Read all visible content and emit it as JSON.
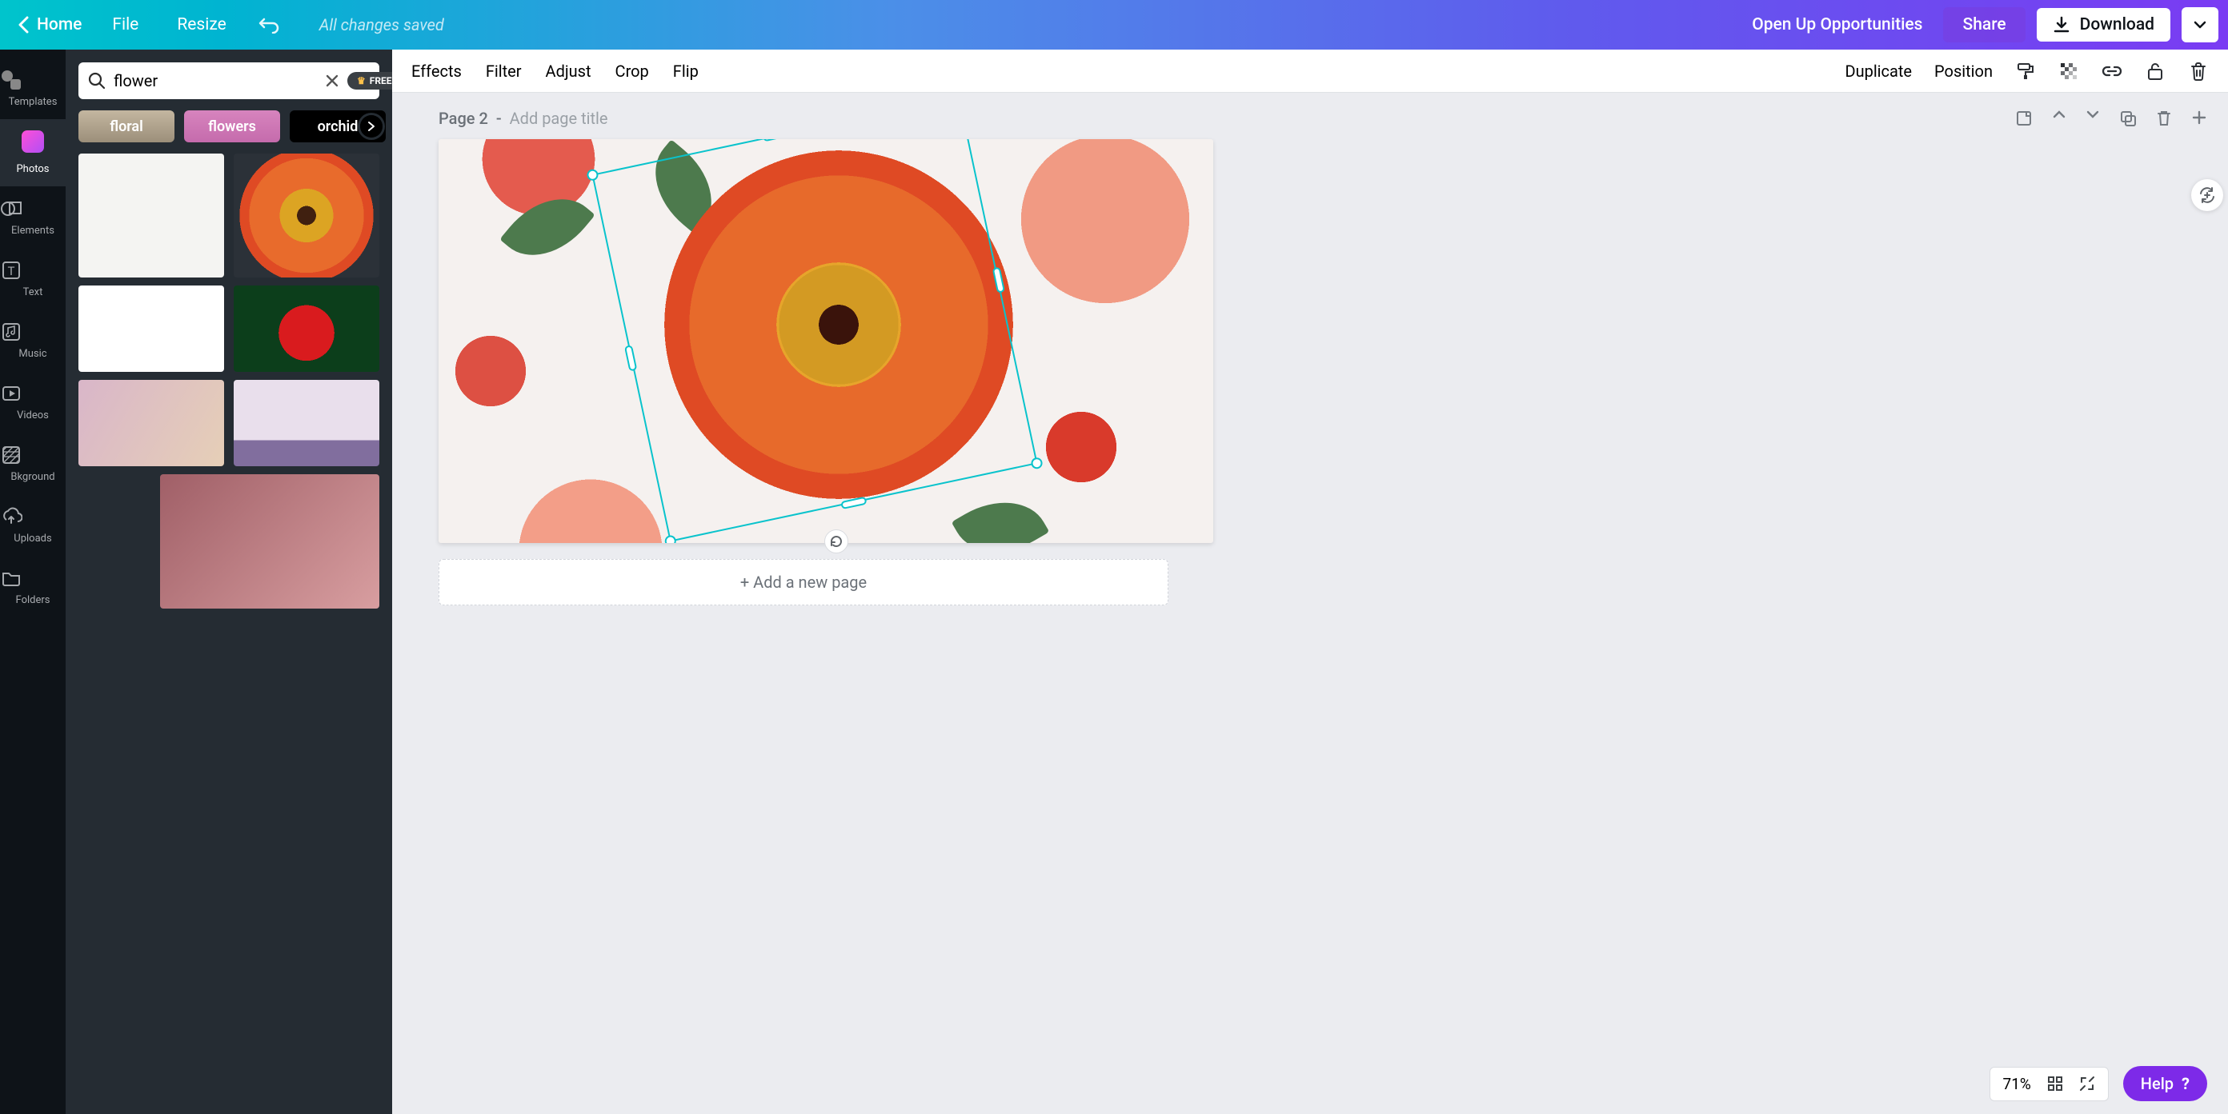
{
  "top": {
    "home": "Home",
    "file": "File",
    "resize": "Resize",
    "status": "All changes saved",
    "opportunities": "Open Up Opportunities",
    "share": "Share",
    "download": "Download"
  },
  "rail": {
    "templates": "Templates",
    "photos": "Photos",
    "elements": "Elements",
    "text": "Text",
    "music": "Music",
    "videos": "Videos",
    "background": "Bkground",
    "uploads": "Uploads",
    "folders": "Folders"
  },
  "search": {
    "value": "flower",
    "free_label": "FREE"
  },
  "chips": {
    "floral": "floral",
    "flowers": "flowers",
    "orchid": "orchid"
  },
  "context": {
    "effects": "Effects",
    "filter": "Filter",
    "adjust": "Adjust",
    "crop": "Crop",
    "flip": "Flip",
    "duplicate": "Duplicate",
    "position": "Position"
  },
  "page": {
    "label": "Page 2",
    "separator": "-",
    "placeholder": "Add page title"
  },
  "add_page": "+ Add a new page",
  "zoom": {
    "value": "71%"
  },
  "help": "Help"
}
